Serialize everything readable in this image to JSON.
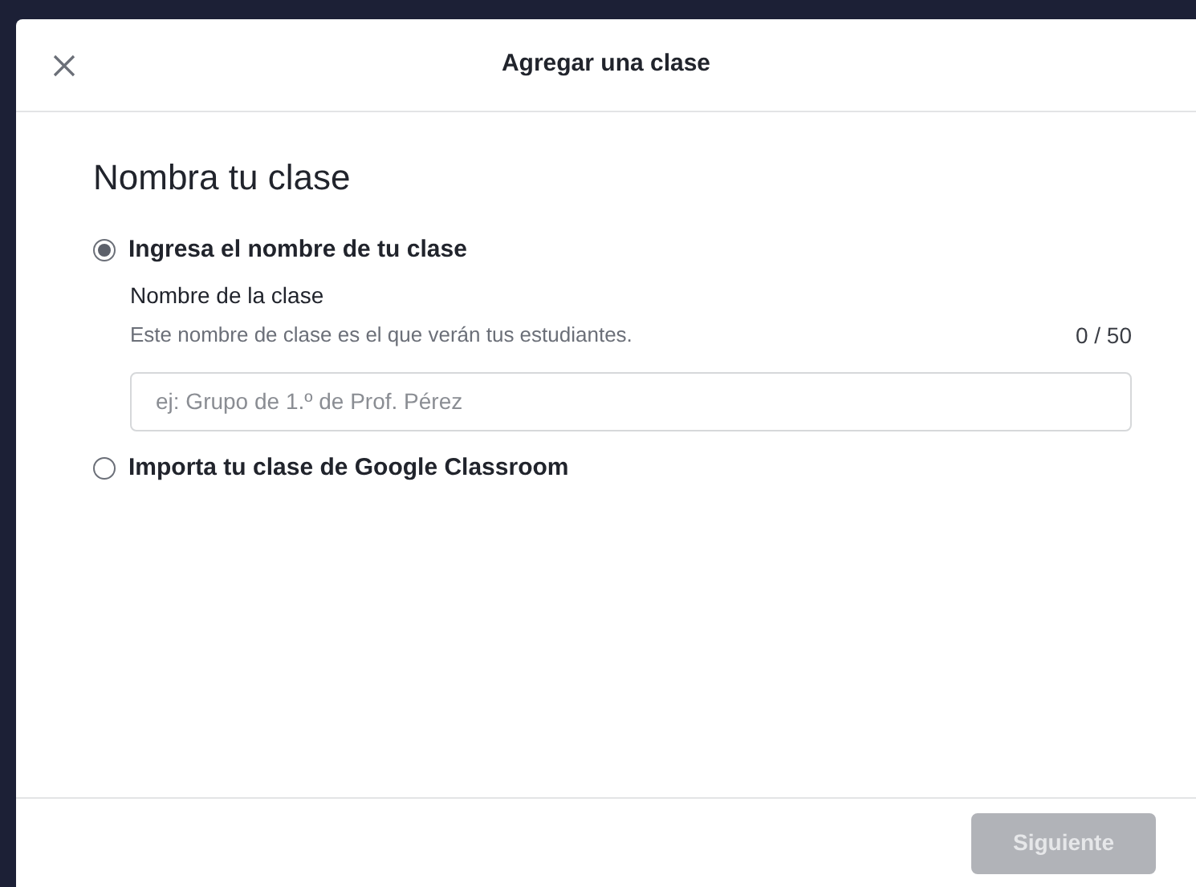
{
  "dialog": {
    "title": "Agregar una clase",
    "heading": "Nombra tu clase"
  },
  "options": [
    {
      "label": "Ingresa el nombre de tu clase",
      "selected": true,
      "field": {
        "label": "Nombre de la clase",
        "description": "Este nombre de clase es el que verán tus estudiantes.",
        "counter": "0 / 50",
        "placeholder": "ej: Grupo de 1.º de Prof. Pérez"
      }
    },
    {
      "label": "Importa tu clase de Google Classroom",
      "selected": false
    }
  ],
  "next_button": {
    "label": "Siguiente",
    "disabled": true
  }
}
